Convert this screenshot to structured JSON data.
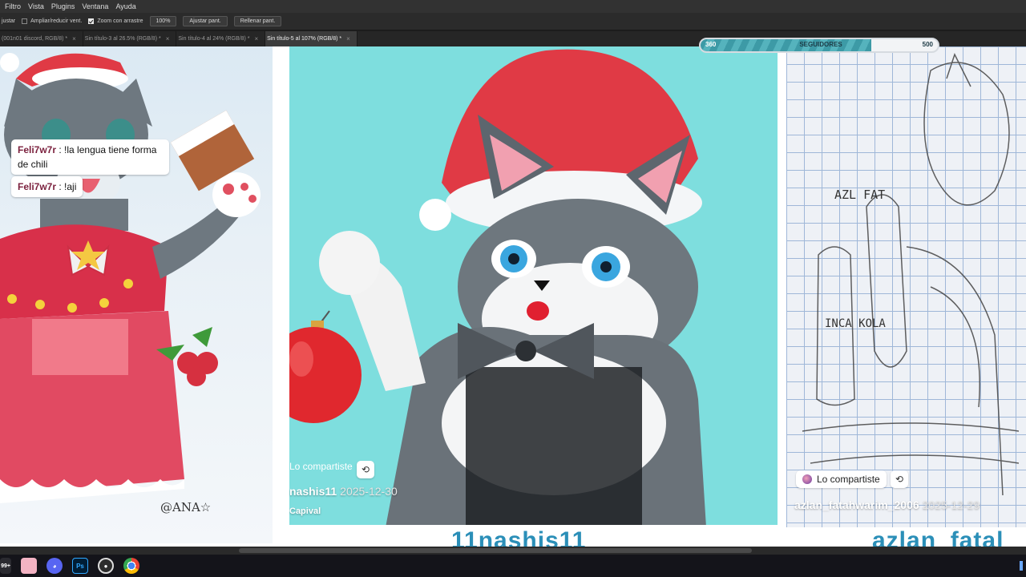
{
  "menu": {
    "items": [
      "Filtro",
      "Vista",
      "Plugins",
      "Ventana",
      "Ayuda"
    ]
  },
  "options": {
    "partial": "justar",
    "resize_windows": "Ampliar/reducir vent.",
    "scrubby_zoom": "Zoom con arrastre",
    "zoom_value": "100%",
    "fit_screen": "Ajustar pant.",
    "fill_screen": "Rellenar pant."
  },
  "tabs": [
    {
      "label": "(001n01 discord, RGB/8) *"
    },
    {
      "label": "Sin título-3 al 26.5% (RGB/8) *"
    },
    {
      "label": "Sin título-4 al 24% (RGB/8) *"
    },
    {
      "label": "Sin título-5 al 107% (RGB/8) *"
    }
  ],
  "follower_bar": {
    "current": "360",
    "label": "SEGUIDORES",
    "goal": "500",
    "progress": 0.72
  },
  "chat": [
    {
      "user": "Feli7w7r",
      "message": ": !la lengua tiene forma de chili"
    },
    {
      "user": "Feli7w7r",
      "message": ": !aji"
    }
  ],
  "left_art": {
    "signature": "@ANA☆"
  },
  "middle_post": {
    "shared_label": "Lo compartiste",
    "author": "nashis11",
    "date": "2025-12-30",
    "extra": "Capival",
    "big_name": "11nashis11"
  },
  "right_post": {
    "shared_label": "Lo compartiste",
    "author": "azlan_fatahwarim_2006",
    "date": "2025-12-29",
    "big_name": "azlan_fatal",
    "sketch_text_1": "AZL FAT",
    "sketch_text_2": "INCA KOLA"
  },
  "taskbar": {
    "badge": "99+",
    "ps_label": "Ps"
  },
  "colors": {
    "accent_teal": "#3d9aa6",
    "canvas_mid": "#7edede",
    "hat_red": "#e03a45"
  }
}
